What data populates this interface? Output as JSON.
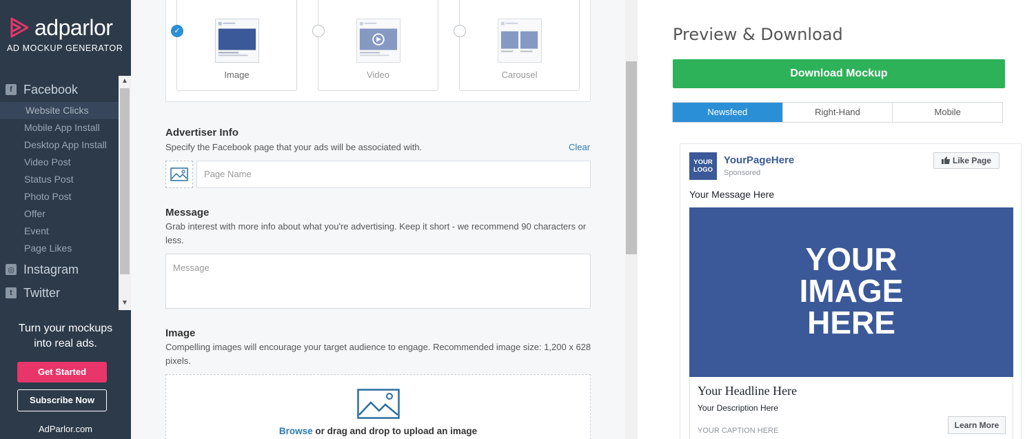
{
  "brand": {
    "name": "adparlor",
    "tagline": "AD MOCKUP GENERATOR"
  },
  "nav": {
    "platforms": [
      {
        "label": "Facebook",
        "icon": "facebook-icon"
      },
      {
        "label": "Instagram",
        "icon": "instagram-icon"
      },
      {
        "label": "Twitter",
        "icon": "twitter-icon"
      }
    ],
    "facebook_items": [
      {
        "label": "Website Clicks",
        "active": true
      },
      {
        "label": "Mobile App Install"
      },
      {
        "label": "Desktop App Install"
      },
      {
        "label": "Video Post"
      },
      {
        "label": "Status Post"
      },
      {
        "label": "Photo Post"
      },
      {
        "label": "Offer"
      },
      {
        "label": "Event"
      },
      {
        "label": "Page Likes"
      }
    ]
  },
  "promo": {
    "text": "Turn your mockups into real ads.",
    "get_started": "Get Started",
    "subscribe": "Subscribe Now",
    "site": "AdParlor.com"
  },
  "ad_types": [
    {
      "label": "Image",
      "selected": true
    },
    {
      "label": "Video",
      "selected": false
    },
    {
      "label": "Carousel",
      "selected": false
    }
  ],
  "advertiser": {
    "title": "Advertiser Info",
    "desc": "Specify the Facebook page that your ads will be associated with.",
    "clear": "Clear",
    "page_placeholder": "Page Name"
  },
  "message": {
    "title": "Message",
    "desc": "Grab interest with more info about what you're advertising. Keep it short - we recommend 90 characters or less.",
    "placeholder": "Message"
  },
  "image": {
    "title": "Image",
    "desc": "Compelling images will encourage your target audience to engage. Recommended image size: 1,200 x 628 pixels.",
    "browse": "Browse",
    "drop_text": " or drag and drop to upload an image"
  },
  "preview": {
    "title": "Preview & Download",
    "download": "Download Mockup",
    "tabs": [
      {
        "label": "Newsfeed",
        "active": true
      },
      {
        "label": "Right-Hand",
        "active": false
      },
      {
        "label": "Mobile",
        "active": false
      }
    ]
  },
  "fb_ad": {
    "logo_line1": "YOUR",
    "logo_line2": "LOGO",
    "page_name": "YourPageHere",
    "sponsored": "Sponsored",
    "like_page": "Like Page",
    "message": "Your Message Here",
    "image_line1": "YOUR",
    "image_line2": "IMAGE",
    "image_line3": "HERE",
    "headline": "Your Headline Here",
    "description": "Your Description Here",
    "caption": "YOUR CAPTION HERE",
    "cta": "Learn More"
  },
  "colors": {
    "sidebar": "#2c3a4a",
    "accent_blue": "#2b8fd6",
    "download_green": "#2db159",
    "get_started_pink": "#e8356a",
    "facebook_blue": "#3b5998"
  }
}
